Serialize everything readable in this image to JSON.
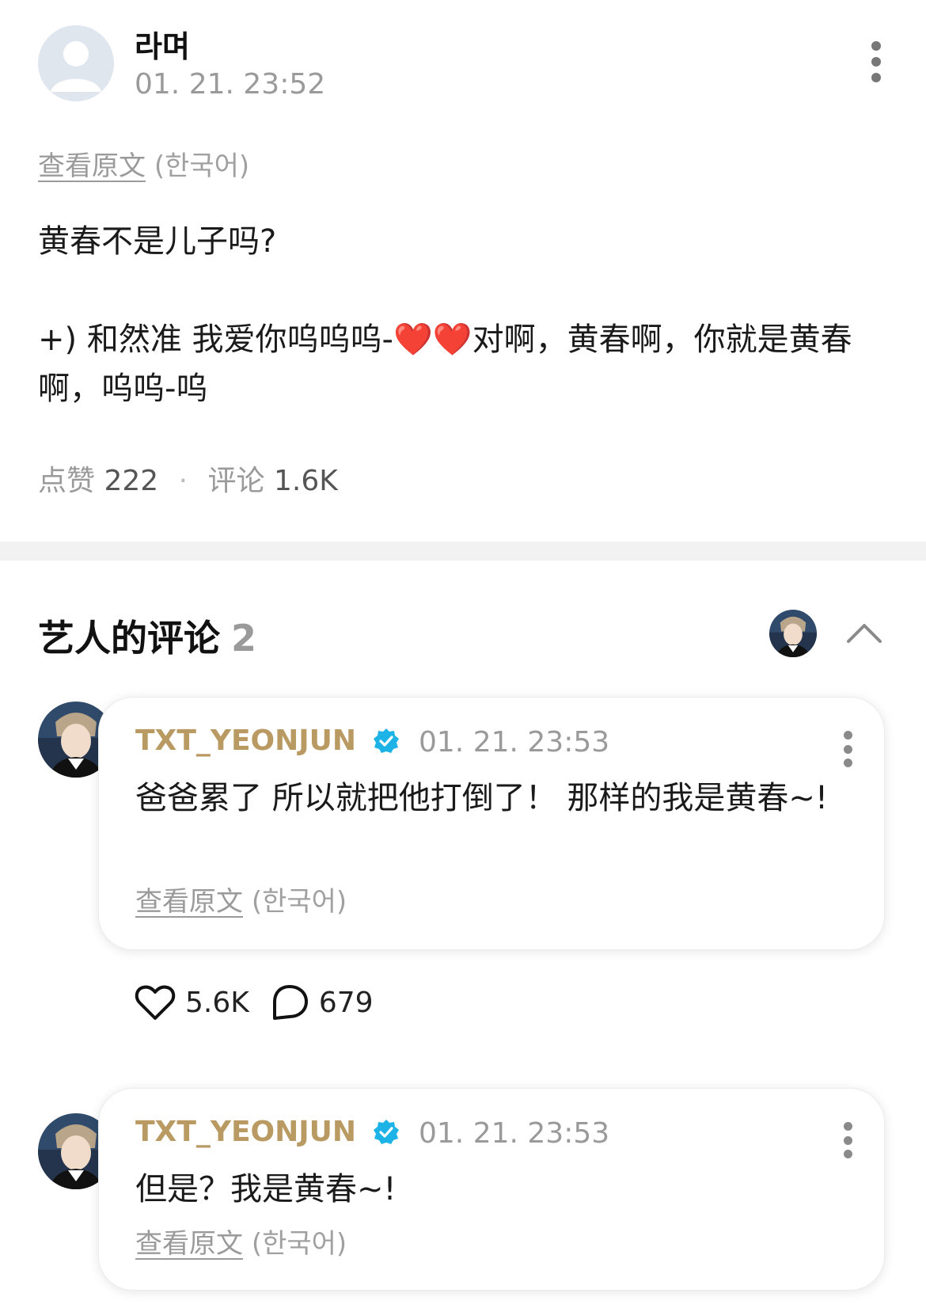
{
  "post": {
    "author": "라며",
    "time": "01. 21. 23:52",
    "translate_link": "查看原文",
    "translate_lang": "(한국어)",
    "body": "黄春不是儿子吗?\n\n+) 和然准 我爱你呜呜呜-❤️❤️对啊，黄春啊，你就是黄春啊，呜呜-呜",
    "likes_label": "点赞",
    "likes_count": "222",
    "separator": "·",
    "comments_label": "评论",
    "comments_count": "1.6K"
  },
  "artist_comments": {
    "title": "艺人的评论",
    "count": "2",
    "items": [
      {
        "name": "TXT_YEONJUN",
        "time": "01. 21. 23:53",
        "text": "爸爸累了 所以就把他打倒了！ 那样的我是黄春~!",
        "translate_link": "查看原文",
        "translate_lang": "(한국어)",
        "like_count": "5.6K",
        "reply_count": "679"
      },
      {
        "name": "TXT_YEONJUN",
        "time": "01. 21. 23:53",
        "text": "但是？我是黄春~!",
        "translate_link": "查看原文",
        "translate_lang": "(한국어)"
      }
    ]
  },
  "colors": {
    "artist_name": "#b99a62",
    "verified_badge": "#1db3e6",
    "muted_text": "#9a9a9a",
    "divider": "#f2f2f2"
  }
}
